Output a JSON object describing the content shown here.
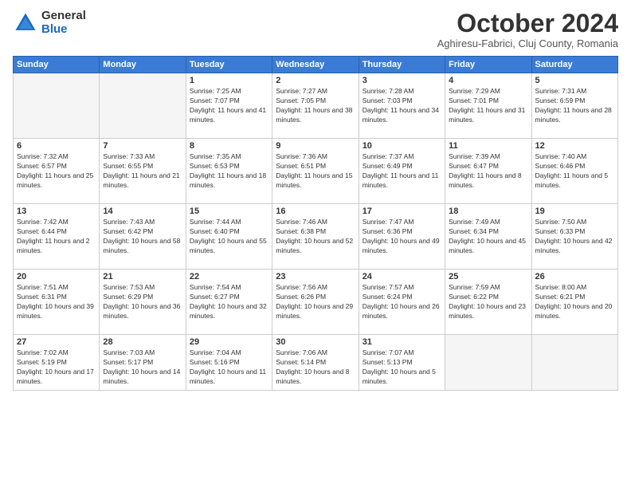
{
  "header": {
    "logo_general": "General",
    "logo_blue": "Blue",
    "month_title": "October 2024",
    "location": "Aghiresu-Fabrici, Cluj County, Romania"
  },
  "days_of_week": [
    "Sunday",
    "Monday",
    "Tuesday",
    "Wednesday",
    "Thursday",
    "Friday",
    "Saturday"
  ],
  "weeks": [
    [
      {
        "day": "",
        "info": ""
      },
      {
        "day": "",
        "info": ""
      },
      {
        "day": "1",
        "info": "Sunrise: 7:25 AM\nSunset: 7:07 PM\nDaylight: 11 hours and 41 minutes."
      },
      {
        "day": "2",
        "info": "Sunrise: 7:27 AM\nSunset: 7:05 PM\nDaylight: 11 hours and 38 minutes."
      },
      {
        "day": "3",
        "info": "Sunrise: 7:28 AM\nSunset: 7:03 PM\nDaylight: 11 hours and 34 minutes."
      },
      {
        "day": "4",
        "info": "Sunrise: 7:29 AM\nSunset: 7:01 PM\nDaylight: 11 hours and 31 minutes."
      },
      {
        "day": "5",
        "info": "Sunrise: 7:31 AM\nSunset: 6:59 PM\nDaylight: 11 hours and 28 minutes."
      }
    ],
    [
      {
        "day": "6",
        "info": "Sunrise: 7:32 AM\nSunset: 6:57 PM\nDaylight: 11 hours and 25 minutes."
      },
      {
        "day": "7",
        "info": "Sunrise: 7:33 AM\nSunset: 6:55 PM\nDaylight: 11 hours and 21 minutes."
      },
      {
        "day": "8",
        "info": "Sunrise: 7:35 AM\nSunset: 6:53 PM\nDaylight: 11 hours and 18 minutes."
      },
      {
        "day": "9",
        "info": "Sunrise: 7:36 AM\nSunset: 6:51 PM\nDaylight: 11 hours and 15 minutes."
      },
      {
        "day": "10",
        "info": "Sunrise: 7:37 AM\nSunset: 6:49 PM\nDaylight: 11 hours and 11 minutes."
      },
      {
        "day": "11",
        "info": "Sunrise: 7:39 AM\nSunset: 6:47 PM\nDaylight: 11 hours and 8 minutes."
      },
      {
        "day": "12",
        "info": "Sunrise: 7:40 AM\nSunset: 6:46 PM\nDaylight: 11 hours and 5 minutes."
      }
    ],
    [
      {
        "day": "13",
        "info": "Sunrise: 7:42 AM\nSunset: 6:44 PM\nDaylight: 11 hours and 2 minutes."
      },
      {
        "day": "14",
        "info": "Sunrise: 7:43 AM\nSunset: 6:42 PM\nDaylight: 10 hours and 58 minutes."
      },
      {
        "day": "15",
        "info": "Sunrise: 7:44 AM\nSunset: 6:40 PM\nDaylight: 10 hours and 55 minutes."
      },
      {
        "day": "16",
        "info": "Sunrise: 7:46 AM\nSunset: 6:38 PM\nDaylight: 10 hours and 52 minutes."
      },
      {
        "day": "17",
        "info": "Sunrise: 7:47 AM\nSunset: 6:36 PM\nDaylight: 10 hours and 49 minutes."
      },
      {
        "day": "18",
        "info": "Sunrise: 7:49 AM\nSunset: 6:34 PM\nDaylight: 10 hours and 45 minutes."
      },
      {
        "day": "19",
        "info": "Sunrise: 7:50 AM\nSunset: 6:33 PM\nDaylight: 10 hours and 42 minutes."
      }
    ],
    [
      {
        "day": "20",
        "info": "Sunrise: 7:51 AM\nSunset: 6:31 PM\nDaylight: 10 hours and 39 minutes."
      },
      {
        "day": "21",
        "info": "Sunrise: 7:53 AM\nSunset: 6:29 PM\nDaylight: 10 hours and 36 minutes."
      },
      {
        "day": "22",
        "info": "Sunrise: 7:54 AM\nSunset: 6:27 PM\nDaylight: 10 hours and 32 minutes."
      },
      {
        "day": "23",
        "info": "Sunrise: 7:56 AM\nSunset: 6:26 PM\nDaylight: 10 hours and 29 minutes."
      },
      {
        "day": "24",
        "info": "Sunrise: 7:57 AM\nSunset: 6:24 PM\nDaylight: 10 hours and 26 minutes."
      },
      {
        "day": "25",
        "info": "Sunrise: 7:59 AM\nSunset: 6:22 PM\nDaylight: 10 hours and 23 minutes."
      },
      {
        "day": "26",
        "info": "Sunrise: 8:00 AM\nSunset: 6:21 PM\nDaylight: 10 hours and 20 minutes."
      }
    ],
    [
      {
        "day": "27",
        "info": "Sunrise: 7:02 AM\nSunset: 5:19 PM\nDaylight: 10 hours and 17 minutes."
      },
      {
        "day": "28",
        "info": "Sunrise: 7:03 AM\nSunset: 5:17 PM\nDaylight: 10 hours and 14 minutes."
      },
      {
        "day": "29",
        "info": "Sunrise: 7:04 AM\nSunset: 5:16 PM\nDaylight: 10 hours and 11 minutes."
      },
      {
        "day": "30",
        "info": "Sunrise: 7:06 AM\nSunset: 5:14 PM\nDaylight: 10 hours and 8 minutes."
      },
      {
        "day": "31",
        "info": "Sunrise: 7:07 AM\nSunset: 5:13 PM\nDaylight: 10 hours and 5 minutes."
      },
      {
        "day": "",
        "info": ""
      },
      {
        "day": "",
        "info": ""
      }
    ]
  ]
}
